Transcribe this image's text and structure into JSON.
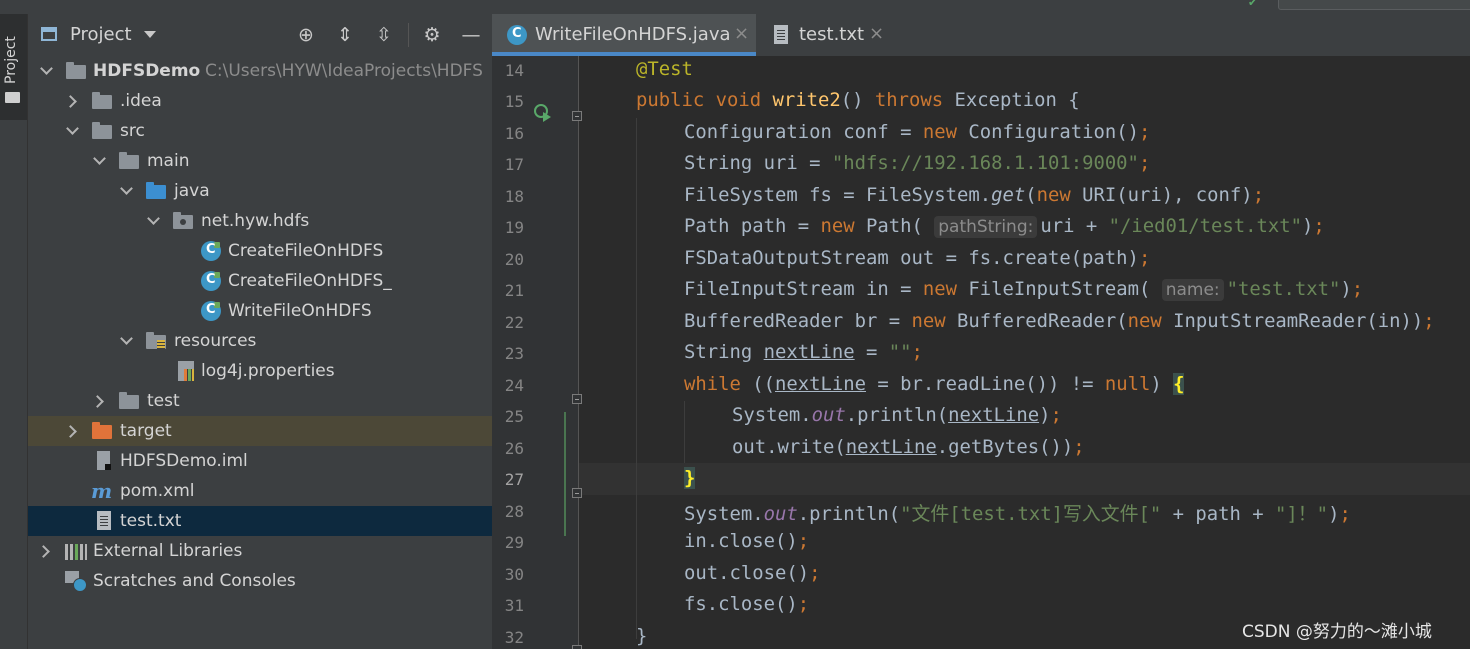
{
  "project_panel": {
    "side_tab_label": "Project",
    "header_title": "Project",
    "tree": [
      {
        "label": "HDFSDemo",
        "path": "C:\\Users\\HYW\\IdeaProjects\\HDFS"
      },
      {
        "label": ".idea"
      },
      {
        "label": "src"
      },
      {
        "label": "main"
      },
      {
        "label": "java"
      },
      {
        "label": "net.hyw.hdfs"
      },
      {
        "label": "CreateFileOnHDFS"
      },
      {
        "label": "CreateFileOnHDFS_"
      },
      {
        "label": "WriteFileOnHDFS"
      },
      {
        "label": "resources"
      },
      {
        "label": "log4j.properties"
      },
      {
        "label": "test"
      },
      {
        "label": "target"
      },
      {
        "label": "HDFSDemo.iml"
      },
      {
        "label": "pom.xml"
      },
      {
        "label": "test.txt"
      },
      {
        "label": "External Libraries"
      },
      {
        "label": "Scratches and Consoles"
      }
    ]
  },
  "editor": {
    "tabs": [
      {
        "label": "WriteFileOnHDFS.java",
        "close": "×"
      },
      {
        "label": "test.txt",
        "close": "×"
      }
    ],
    "line_numbers": [
      "14",
      "15",
      "16",
      "17",
      "18",
      "19",
      "20",
      "21",
      "22",
      "23",
      "24",
      "25",
      "26",
      "27",
      "28",
      "29",
      "30",
      "31",
      "32"
    ],
    "current_line": "27",
    "hints": {
      "path_string": "pathString:",
      "name": "name:"
    },
    "code": {
      "l14_annotation": "@Test",
      "l15_public": "public ",
      "l15_void": "void ",
      "l15_name": "write2",
      "l15_params": "() ",
      "l15_throws": "throws ",
      "l15_rest": "Exception {",
      "l16_a": "Configuration conf = ",
      "l16_new": "new ",
      "l16_b": "Configuration()",
      "l16_semi": ";",
      "l17_a": "String uri = ",
      "l17_str": "\"hdfs://192.168.1.101:9000\"",
      "l17_semi": ";",
      "l18_a": "FileSystem fs = FileSystem.",
      "l18_get": "get",
      "l18_b": "(",
      "l18_new": "new ",
      "l18_c": "URI(uri), conf)",
      "l18_semi": ";",
      "l19_a": "Path path = ",
      "l19_new": "new ",
      "l19_b": "Path( ",
      "l19_c": "uri + ",
      "l19_str": "\"/ied01/test.txt\"",
      "l19_d": ")",
      "l19_semi": ";",
      "l20_a": "FSDataOutputStream out = fs.create(path)",
      "l20_semi": ";",
      "l21_a": "FileInputStream in = ",
      "l21_new": "new ",
      "l21_b": "FileInputStream( ",
      "l21_str": "\"test.txt\"",
      "l21_c": ")",
      "l21_semi": ";",
      "l22_a": "BufferedReader br = ",
      "l22_new": "new ",
      "l22_b": "BufferedReader(",
      "l22_new2": "new ",
      "l22_c": "InputStreamReader(in))",
      "l22_semi": ";",
      "l23_a": "String ",
      "l23_var": "nextLine",
      "l23_b": " = ",
      "l23_str": "\"\"",
      "l23_semi": ";",
      "l24_while": "while ",
      "l24_a": "((",
      "l24_var": "nextLine",
      "l24_b": " = br.readLine()) != ",
      "l24_null": "null",
      "l24_c": ") ",
      "l24_brace": "{",
      "l25_a": "System.",
      "l25_out": "out",
      "l25_b": ".println(",
      "l25_var": "nextLine",
      "l25_c": ")",
      "l25_semi": ";",
      "l26_a": "out.write(",
      "l26_var": "nextLine",
      "l26_b": ".getBytes())",
      "l26_semi": ";",
      "l27_brace": "}",
      "l28_a": "System.",
      "l28_out": "out",
      "l28_b": ".println(",
      "l28_str": "\"文件[test.txt]写入文件[\"",
      "l28_c": " + path + ",
      "l28_str2": "\"]！\"",
      "l28_d": ")",
      "l28_semi": ";",
      "l29_a": "in.close()",
      "l29_semi": ";",
      "l30_a": "out.close()",
      "l30_semi": ";",
      "l31_a": "fs.close()",
      "l31_semi": ";",
      "l32_brace": "}"
    }
  },
  "watermark": "CSDN @努力的～滩小城",
  "colors": {
    "keyword": "#cc7832",
    "string": "#6a8759",
    "annotation": "#bbb529",
    "method_decl": "#ffc66d",
    "static_field": "#9876aa",
    "default_text": "#a9b7c6",
    "selected_row": "#0d293e",
    "target_row": "#4c4837"
  }
}
